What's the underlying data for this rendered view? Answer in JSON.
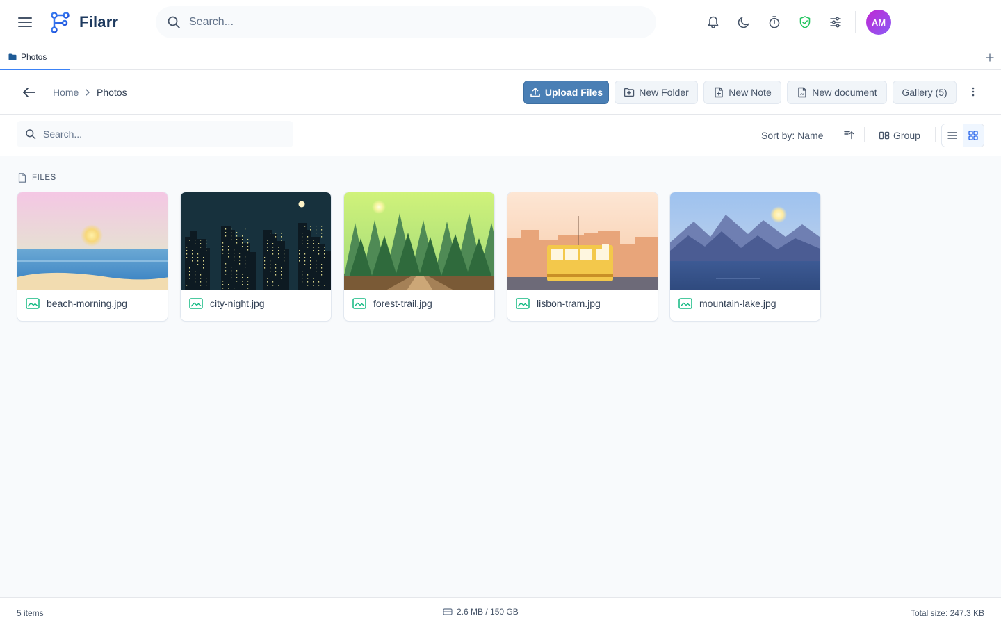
{
  "app": {
    "name": "Filarr",
    "search_placeholder": "Search...",
    "avatar_initials": "AM",
    "accent_color": "#4a7fb5",
    "shield_color": "#22c55e",
    "avatar_gradient": [
      "#c026d3",
      "#8b5cf6"
    ]
  },
  "topbar_icons": [
    "bell-icon",
    "moon-icon",
    "timer-icon",
    "shield-check-icon",
    "sliders-icon"
  ],
  "tabs": [
    {
      "label": "Photos",
      "active": true
    }
  ],
  "breadcrumb": {
    "home": "Home",
    "current": "Photos"
  },
  "toolbar": {
    "upload": "Upload Files",
    "new_folder": "New Folder",
    "new_note": "New Note",
    "new_document": "New document",
    "gallery": "Gallery (5)"
  },
  "filter": {
    "search_placeholder": "Search...",
    "sort_label": "Sort by: Name",
    "group_label": "Group",
    "view": "grid"
  },
  "section": {
    "title": "FILES"
  },
  "files": [
    {
      "name": "beach-morning.jpg",
      "thumb": "beach"
    },
    {
      "name": "city-night.jpg",
      "thumb": "city"
    },
    {
      "name": "forest-trail.jpg",
      "thumb": "forest"
    },
    {
      "name": "lisbon-tram.jpg",
      "thumb": "tram"
    },
    {
      "name": "mountain-lake.jpg",
      "thumb": "mountain"
    }
  ],
  "status": {
    "count": "5 items",
    "storage": "2.6 MB / 150 GB",
    "total_size": "Total size: 247.3 KB"
  }
}
